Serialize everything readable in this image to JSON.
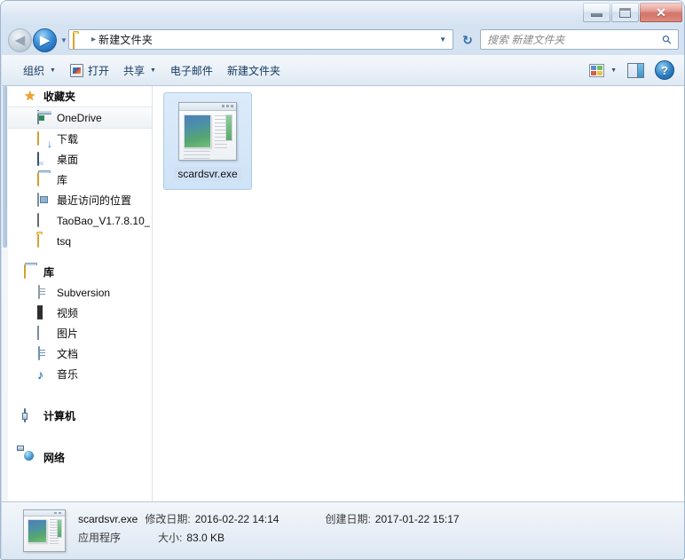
{
  "window": {
    "controls": {
      "minimize": "–",
      "maximize": "□",
      "close": "✕"
    }
  },
  "navigation": {
    "back_label": "◀",
    "forward_label": "▶",
    "history_caret": "▼",
    "refresh_label": "↻"
  },
  "address": {
    "folder_icon": "folder-icon",
    "separator": "▸",
    "path": "新建文件夹",
    "dropdown_caret": "▼"
  },
  "search": {
    "placeholder": "搜索 新建文件夹",
    "icon": "search-icon"
  },
  "toolbar": {
    "organize": "组织",
    "open": "打开",
    "share": "共享",
    "email": "电子邮件",
    "new_folder": "新建文件夹",
    "caret": "▼",
    "view_caret": "▼",
    "help": "?"
  },
  "sidebar": {
    "groups": [
      {
        "label": "收藏夹",
        "icon": "star-icon",
        "items": [
          {
            "label": "OneDrive",
            "icon": "onedrive-icon",
            "selected": true
          },
          {
            "label": "下载",
            "icon": "download-folder-icon",
            "selected": false
          },
          {
            "label": "桌面",
            "icon": "desktop-icon",
            "selected": false
          },
          {
            "label": "库",
            "icon": "library-icon",
            "selected": false
          },
          {
            "label": "最近访问的位置",
            "icon": "recent-places-icon",
            "selected": false
          },
          {
            "label": "TaoBao_V1.7.8.10_",
            "icon": "archive-icon",
            "selected": false
          },
          {
            "label": "tsq",
            "icon": "folder-icon",
            "selected": false
          }
        ]
      },
      {
        "label": "库",
        "icon": "library-icon",
        "items": [
          {
            "label": "Subversion",
            "icon": "document-icon",
            "selected": false
          },
          {
            "label": "视频",
            "icon": "video-icon",
            "selected": false
          },
          {
            "label": "图片",
            "icon": "picture-icon",
            "selected": false
          },
          {
            "label": "文档",
            "icon": "document-icon",
            "selected": false
          },
          {
            "label": "音乐",
            "icon": "music-note-icon",
            "selected": false
          }
        ]
      },
      {
        "label": "计算机",
        "icon": "computer-icon",
        "items": []
      },
      {
        "label": "网络",
        "icon": "network-icon",
        "items": []
      }
    ]
  },
  "files": [
    {
      "name": "scardsvr.exe",
      "icon": "application-exe-icon",
      "selected": true
    }
  ],
  "details": {
    "name": "scardsvr.exe",
    "modified_label": "修改日期:",
    "modified_value": "2016-02-22 14:14",
    "created_label": "创建日期:",
    "created_value": "2017-01-22 15:17",
    "type": "应用程序",
    "size_label": "大小:",
    "size_value": "83.0 KB"
  },
  "colors": {
    "frame": "#cfdced",
    "accent": "#2f6cab",
    "selection": "#cfe3f7",
    "close_button": "#c24a3c"
  }
}
